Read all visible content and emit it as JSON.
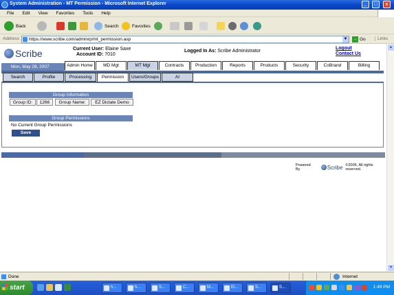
{
  "window": {
    "title": "System Administration - MT Permission - Microsoft Internet Explorer",
    "min_label": "_",
    "max_label": "□",
    "close_label": "x"
  },
  "menu": [
    "File",
    "Edit",
    "View",
    "Favorites",
    "Tools",
    "Help"
  ],
  "toolbar": {
    "back_label": "Back",
    "search_label": "Search",
    "favorites_label": "Favorites"
  },
  "address": {
    "label": "Address",
    "url": "https://www.scribe.com/adminrp/mt_permission.asp",
    "go_label": "Go",
    "links_label": "Links"
  },
  "header": {
    "logo_text": "Scribe",
    "current_user_label": "Current User:",
    "current_user": "Elaine Saxe",
    "account_id_label": "Account ID:",
    "account_id": "7010",
    "logged_in_label": "Logged In As:",
    "logged_in_as": "Scribe Administrator",
    "logout_label": "Logout",
    "contact_label": "Contact Us",
    "date": "Mon, May 28, 2007"
  },
  "main_tabs": [
    {
      "label": "Admin Home"
    },
    {
      "label": "MD Mgt"
    },
    {
      "label": "MT Mgt"
    },
    {
      "label": "Contracts"
    },
    {
      "label": "Production"
    },
    {
      "label": "Reports"
    },
    {
      "label": "Products"
    },
    {
      "label": "Security"
    },
    {
      "label": "CoBrand"
    },
    {
      "label": "Billing"
    }
  ],
  "sub_tabs": [
    {
      "label": "Search"
    },
    {
      "label": "Profile"
    },
    {
      "label": "Processing"
    },
    {
      "label": "Permission"
    },
    {
      "label": "Users/Groups"
    },
    {
      "label": "AI"
    }
  ],
  "group_info": {
    "heading": "Group Information",
    "group_id_label": "Group ID:",
    "group_id": "1266",
    "group_name_label": "Group Name:",
    "group_name": "EZ Dictate Demo"
  },
  "group_permissions": {
    "heading": "Group Permissions",
    "empty_text": "No Current Group Permissions",
    "save_label": "Save"
  },
  "footer": {
    "powered_by": "Powered By",
    "logo_text": "Scribe",
    "copyright": "©2005, All rights reserved."
  },
  "status": {
    "text": "Done",
    "zone": "Internet"
  },
  "taskbar": {
    "start_label": "start",
    "tasks": [
      "h...",
      "h...",
      "S...",
      "C...",
      "M...",
      "El...",
      "S...",
      "S..."
    ],
    "clock": "1:49 PM"
  },
  "colors": {
    "accent_blue": "#6b85b8",
    "nav_blue": "#4a6aa6",
    "link": "#0000cc"
  }
}
